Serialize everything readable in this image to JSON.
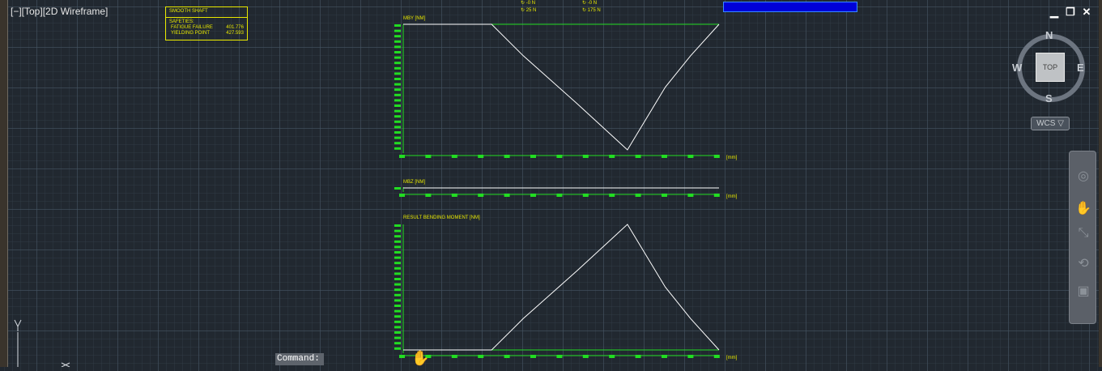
{
  "viewport": {
    "label": "[−][Top][2D Wireframe]"
  },
  "window_controls": {
    "minimize": "▁",
    "restore": "❐",
    "close": "✕"
  },
  "title_block": {
    "heading": "SMOOTH SHAFT",
    "section": "SAFETIES:",
    "rows": [
      {
        "label": "FATIGUE FAILURE",
        "value": "401.776"
      },
      {
        "label": "YIELDING POINT",
        "value": "427.593"
      }
    ]
  },
  "forces": {
    "col1": [
      "↻ -0 N",
      "↻ 25 N"
    ],
    "col2": [
      "↻ -0 N",
      "↻ 175 N"
    ]
  },
  "chart_data": [
    {
      "type": "line",
      "title": "MBY [NM]",
      "xlabel": "[mm]",
      "x": [
        0,
        28,
        38,
        55,
        71,
        83,
        91,
        100
      ],
      "values": [
        0,
        0,
        -0.25,
        -0.63,
        -1.0,
        -0.5,
        -0.25,
        0
      ],
      "note_series_color": "#ffffff"
    },
    {
      "type": "line",
      "title": "MBZ [NM]",
      "xlabel": "[mm]",
      "x": [
        0,
        100
      ],
      "values": [
        0,
        0
      ]
    },
    {
      "type": "line",
      "title": "RESULT BENDING MOMENT [NM]",
      "xlabel": "[mm]",
      "x": [
        0,
        28,
        38,
        55,
        71,
        83,
        91,
        100
      ],
      "values": [
        0,
        0,
        0.25,
        0.63,
        1.0,
        0.5,
        0.25,
        0
      ]
    }
  ],
  "viewcube": {
    "top": "TOP",
    "north": "N",
    "south": "S",
    "east": "E",
    "west": "W",
    "wcs": "WCS ▽"
  },
  "command": {
    "label": "Command:"
  },
  "ucs": {
    "y_label": "Y"
  },
  "colors": {
    "background": "#212830",
    "plot_axis": "#22dd22",
    "plot_label": "#e8e800",
    "curve": "#ffffff"
  }
}
